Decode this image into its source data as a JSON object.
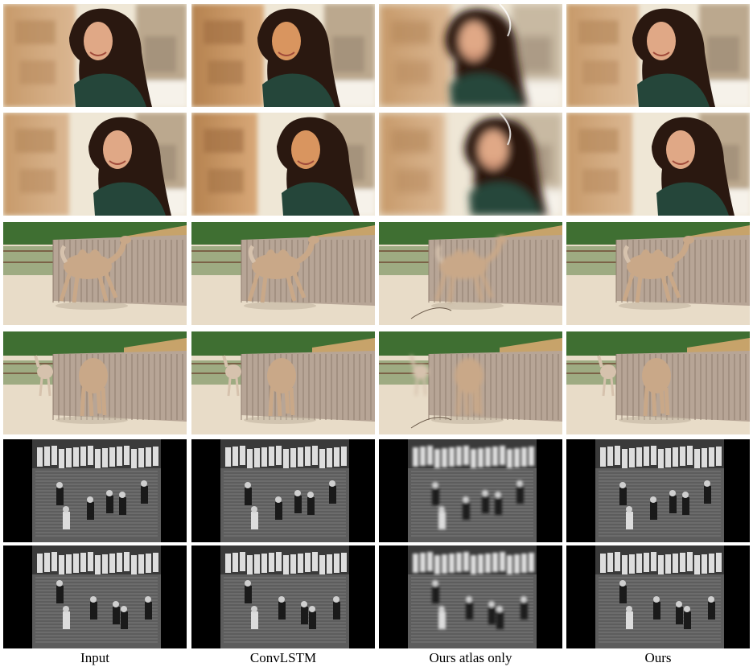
{
  "columns": [
    {
      "label": "Input",
      "style": "sharp"
    },
    {
      "label": "ConvLSTM",
      "style": "warm"
    },
    {
      "label": "Ours atlas only",
      "style": "smeared"
    },
    {
      "label": "Ours",
      "style": "sharp"
    }
  ],
  "rows": [
    {
      "scene": "woman-portrait",
      "variant": "a"
    },
    {
      "scene": "woman-portrait",
      "variant": "b"
    },
    {
      "scene": "camel-enclosure",
      "variant": "a"
    },
    {
      "scene": "camel-enclosure",
      "variant": "b"
    },
    {
      "scene": "bw-staircase-crowd",
      "variant": "a"
    },
    {
      "scene": "bw-staircase-crowd",
      "variant": "b"
    }
  ],
  "colors": {
    "sky": "#efe7d6",
    "stone": "#c79a6a",
    "hair": "#2a1810",
    "skin": "#e0a886",
    "sweater": "#25463a",
    "hedge": "#3f6f32",
    "fence": "#b7a596",
    "sand": "#e8dcc8",
    "camel": "#c9a888",
    "bw_bg": "#000000",
    "bw_stairs": "#5d5d5d"
  }
}
